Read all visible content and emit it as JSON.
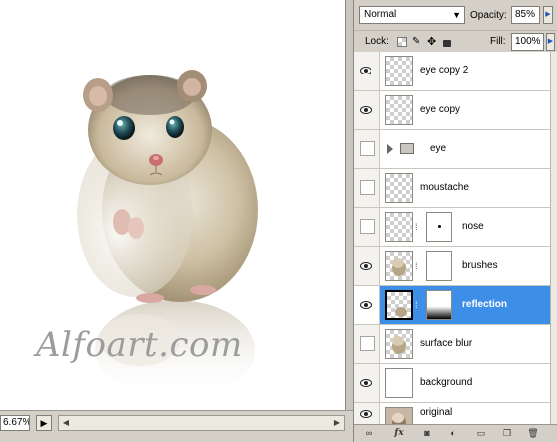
{
  "canvas": {
    "watermark": "Alfoart.com",
    "zoom": "6.67%",
    "background_color": "#ffffff"
  },
  "panel": {
    "blend_mode": "Normal",
    "opacity_label": "Opacity:",
    "opacity_value": "85%",
    "lock_label": "Lock:",
    "fill_label": "Fill:",
    "fill_value": "100%"
  },
  "layers": [
    {
      "name": "eye copy 2",
      "visible": true,
      "thumb": "checker",
      "mask": false,
      "selected": false
    },
    {
      "name": "eye copy",
      "visible": true,
      "thumb": "checker",
      "mask": false,
      "selected": false
    },
    {
      "name": "eye",
      "visible": false,
      "thumb": "folder",
      "mask": false,
      "selected": false
    },
    {
      "name": "moustache",
      "visible": false,
      "thumb": "checker",
      "mask": false,
      "selected": false
    },
    {
      "name": "nose",
      "visible": false,
      "thumb": "checker",
      "mask": true,
      "selected": false
    },
    {
      "name": "brushes",
      "visible": true,
      "thumb": "hamster",
      "mask": true,
      "selected": false
    },
    {
      "name": "reflection",
      "visible": true,
      "thumb": "hamster",
      "mask": true,
      "selected": true
    },
    {
      "name": "surface blur",
      "visible": false,
      "thumb": "hamster",
      "mask": false,
      "selected": false
    },
    {
      "name": "background",
      "visible": true,
      "thumb": "white",
      "mask": false,
      "selected": false
    },
    {
      "name": "original",
      "visible": true,
      "thumb": "photo",
      "mask": false,
      "selected": false
    }
  ],
  "colors": {
    "selection": "#3d8ee6",
    "panel_bg": "#d4d0c8"
  }
}
